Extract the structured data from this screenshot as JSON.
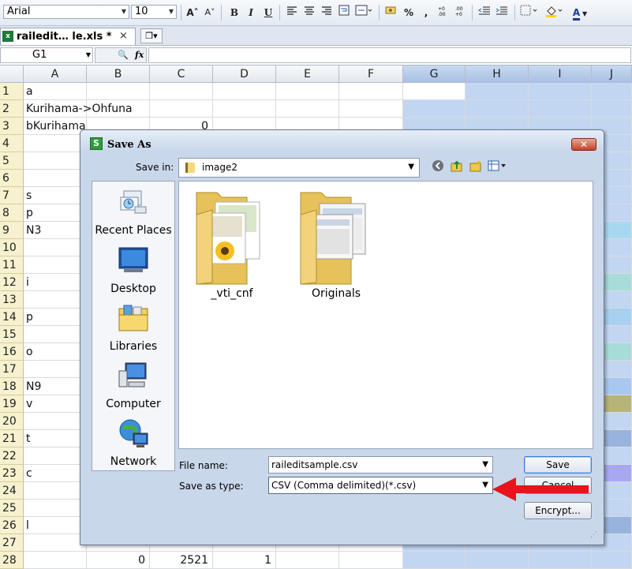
{
  "toolbar": {
    "font_name": "Arial",
    "font_size": "10",
    "icons": [
      "font-grow-icon",
      "font-shrink-icon",
      "bold-icon",
      "italic-icon",
      "underline-icon",
      "align-left-icon",
      "align-center-icon",
      "align-right-icon",
      "wrap-text-icon",
      "merge-icon",
      "currency-icon",
      "percent-icon",
      "comma-icon",
      "decimal-increase-icon",
      "decimal-decrease-icon",
      "indent-decrease-icon",
      "indent-increase-icon",
      "borders-icon",
      "fill-color-icon",
      "font-color-icon"
    ],
    "glyphs": {
      "grow": "A˄",
      "shrink": "A˅",
      "bold": "B",
      "italic": "I",
      "underline": "U",
      "percent": "%",
      "comma": ",",
      "font_color": "A"
    }
  },
  "tab": {
    "title": "railedit… le.xls *",
    "close": "×",
    "new": "❐▾"
  },
  "formula_bar": {
    "cell_ref": "G1",
    "fx": "fx",
    "value": ""
  },
  "grid": {
    "columns": [
      "A",
      "B",
      "C",
      "D",
      "E",
      "F",
      "G",
      "H",
      "I",
      "J"
    ],
    "selected_columns": [
      "G",
      "H",
      "I",
      "J"
    ],
    "rows": [
      "1",
      "2",
      "3",
      "4",
      "5",
      "6",
      "7",
      "8",
      "9",
      "10",
      "11",
      "12",
      "13",
      "14",
      "15",
      "16",
      "17",
      "18",
      "19",
      "20",
      "21",
      "22",
      "23",
      "24",
      "25",
      "26",
      "27",
      "28"
    ],
    "cells": {
      "A1": "a",
      "A2": "Kurihama->Ohfuna",
      "A3": "bKurihama",
      "C3": "0",
      "A7": "s",
      "A8": "p",
      "A9": "N3",
      "A12": "i",
      "A14": "p",
      "A16": "o",
      "A18": "N9",
      "A19": "v",
      "A21": "t",
      "A23": "c",
      "A26": "l",
      "B28": "0",
      "C28": "2521",
      "D28": "1"
    },
    "row_colors": {
      "9": "#a8d8f0",
      "12": "#a8dcd8",
      "14": "#a8d0f0",
      "16": "#a8dcd8",
      "18": "#a8c8f0",
      "19": "#b8b478",
      "21": "#98b4dc",
      "23": "#a8a8f0",
      "26": "#98b4dc"
    }
  },
  "dialog": {
    "title": "Save As",
    "close_glyph": "✕",
    "save_in_label": "Save in:",
    "save_in_value": "image2",
    "places": [
      {
        "label": "Recent Places",
        "icon": "recent-places-icon"
      },
      {
        "label": "Desktop",
        "icon": "desktop-icon"
      },
      {
        "label": "Libraries",
        "icon": "libraries-icon"
      },
      {
        "label": "Computer",
        "icon": "computer-icon"
      },
      {
        "label": "Network",
        "icon": "network-icon"
      }
    ],
    "files": [
      {
        "name": "_vti_cnf",
        "icon": "folder-icon"
      },
      {
        "name": "Originals",
        "icon": "folder-icon"
      }
    ],
    "file_name_label": "File name:",
    "file_name_value": "raileditsample.csv",
    "save_type_label": "Save as type:",
    "save_type_value": "CSV (Comma delimited)(*.csv)",
    "save_button": "Save",
    "cancel_button": "Cancel",
    "encrypt_button": "Encrypt...",
    "nav_icons": [
      "back-icon",
      "up-folder-icon",
      "new-folder-icon",
      "view-menu-icon"
    ]
  },
  "annotation": {
    "arrow_color": "#e8141c"
  }
}
